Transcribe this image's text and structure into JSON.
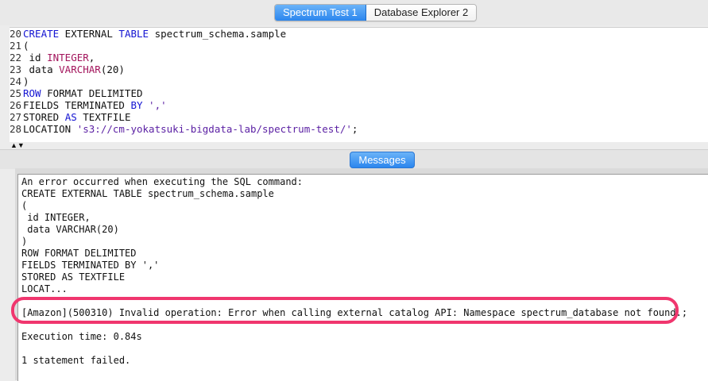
{
  "tabs": [
    "Spectrum Test 1",
    "Database Explorer 2"
  ],
  "editor": {
    "lines": [
      {
        "num": "20",
        "segments": [
          {
            "t": "CREATE",
            "c": "kw"
          },
          {
            "t": " EXTERNAL ",
            "c": "code"
          },
          {
            "t": "TABLE",
            "c": "kw"
          },
          {
            "t": " spectrum_schema.sample",
            "c": "code"
          }
        ]
      },
      {
        "num": "21",
        "segments": [
          {
            "t": "(",
            "c": "code"
          }
        ]
      },
      {
        "num": "22",
        "segments": [
          {
            "t": " id ",
            "c": "code"
          },
          {
            "t": "INTEGER",
            "c": "ty"
          },
          {
            "t": ",",
            "c": "code"
          }
        ]
      },
      {
        "num": "23",
        "segments": [
          {
            "t": " data ",
            "c": "code"
          },
          {
            "t": "VARCHAR",
            "c": "ty"
          },
          {
            "t": "(20)",
            "c": "code"
          }
        ]
      },
      {
        "num": "24",
        "segments": [
          {
            "t": ")",
            "c": "code"
          }
        ]
      },
      {
        "num": "25",
        "segments": [
          {
            "t": "ROW",
            "c": "kw"
          },
          {
            "t": " FORMAT DELIMITED",
            "c": "code"
          }
        ]
      },
      {
        "num": "26",
        "segments": [
          {
            "t": "FIELDS TERMINATED ",
            "c": "code"
          },
          {
            "t": "BY",
            "c": "kw"
          },
          {
            "t": " ','",
            "c": "str"
          }
        ]
      },
      {
        "num": "27",
        "segments": [
          {
            "t": "STORED ",
            "c": "code"
          },
          {
            "t": "AS",
            "c": "kw"
          },
          {
            "t": " TEXTFILE",
            "c": "code"
          }
        ]
      },
      {
        "num": "28",
        "segments": [
          {
            "t": "LOCATION ",
            "c": "code"
          },
          {
            "t": "'s3://cm-yokatsuki-bigdata-lab/spectrum-test/'",
            "c": "str"
          },
          {
            "t": ";",
            "c": "code"
          }
        ]
      }
    ]
  },
  "messages": {
    "button_label": "Messages",
    "lines": [
      "An error occurred when executing the SQL command:",
      "CREATE EXTERNAL TABLE spectrum_schema.sample",
      "(",
      " id INTEGER,",
      " data VARCHAR(20)",
      ")",
      "ROW FORMAT DELIMITED",
      "FIELDS TERMINATED BY ','",
      "STORED AS TEXTFILE",
      "LOCAT..."
    ],
    "error": "[Amazon](500310) Invalid operation: Error when calling external catalog API: Namespace spectrum_database not found.;",
    "execution_time": "Execution time: 0.84s",
    "summary": "1 statement failed."
  }
}
